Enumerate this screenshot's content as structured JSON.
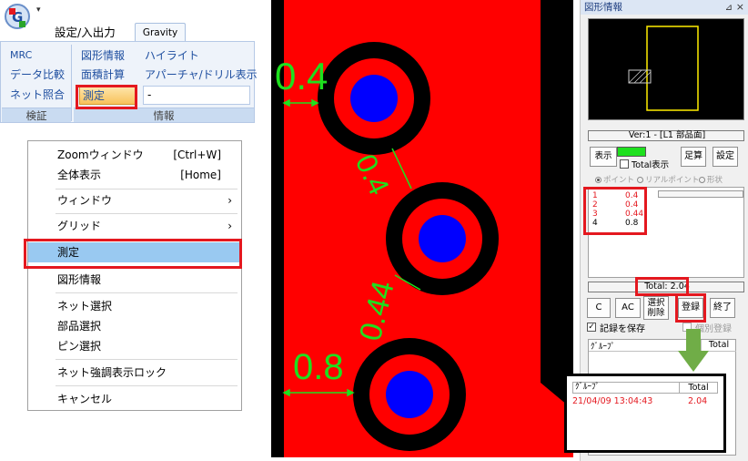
{
  "ribbon": {
    "tabs": [
      "設定/入出力",
      "Gravity"
    ],
    "verify_group": {
      "label": "検証",
      "buttons": [
        "MRC",
        "データ比較",
        "ネット照合"
      ]
    },
    "info_group": {
      "label": "情報",
      "buttons": [
        "図形情報",
        "面積計算",
        "測定",
        "ハイライト",
        "アパーチャ/ドリル表示"
      ],
      "field_value": "-"
    }
  },
  "context_menu": {
    "items": [
      {
        "label": "Zoomウィンドウ",
        "shortcut": "[Ctrl+W]"
      },
      {
        "label": "全体表示",
        "shortcut": "[Home]"
      },
      {
        "label": "ウィンドウ",
        "arrow": "›"
      },
      {
        "label": "グリッド",
        "arrow": "›"
      },
      {
        "label": "測定"
      },
      {
        "label": "図形情報"
      },
      {
        "label": "ネット選択"
      },
      {
        "label": "部品選択"
      },
      {
        "label": "ピン選択"
      },
      {
        "label": "ネット強調表示ロック"
      },
      {
        "label": "キャンセル"
      }
    ]
  },
  "canvas": {
    "measure_labels": [
      "0.4",
      "0.4",
      "0.44",
      "0.8"
    ],
    "colors": {
      "copper": "#ff0000",
      "pad_ring": "#000000",
      "drill": "#0000ff",
      "measure": "#1ee01e"
    }
  },
  "panel": {
    "title": "図形情報",
    "pin_icon": "pin-icon",
    "version": "Ver:1 - [L1 部品面]",
    "show_label": "表示",
    "total_check_label": "Total表示",
    "addup_label": "足算",
    "setting_label": "設定",
    "radio": [
      "ポイント",
      "リアルポイント",
      "形状"
    ],
    "measurements": [
      {
        "index": "1",
        "value": "0.4",
        "color": "#e4181f"
      },
      {
        "index": "2",
        "value": "0.4",
        "color": "#e4181f"
      },
      {
        "index": "3",
        "value": "0.44",
        "color": "#e4181f"
      },
      {
        "index": "4",
        "value": "0.8",
        "color": "#000000"
      }
    ],
    "total": "Total: 2.04",
    "buttons": {
      "c": "C",
      "ac": "AC",
      "sel_delete": "選択削除",
      "register": "登録",
      "exit": "終了"
    },
    "save_record_label": "記録を保存",
    "individual_register_label": "個別登録",
    "group_table": {
      "col_group": "ｸﾞﾙｰﾌﾟ",
      "col_total": "Total"
    }
  },
  "zoom_popup": {
    "col_group": "ｸﾞﾙｰﾌﾟ",
    "col_total": "Total",
    "row": {
      "date": "21/04/09 13:04:43",
      "total": "2.04"
    }
  }
}
